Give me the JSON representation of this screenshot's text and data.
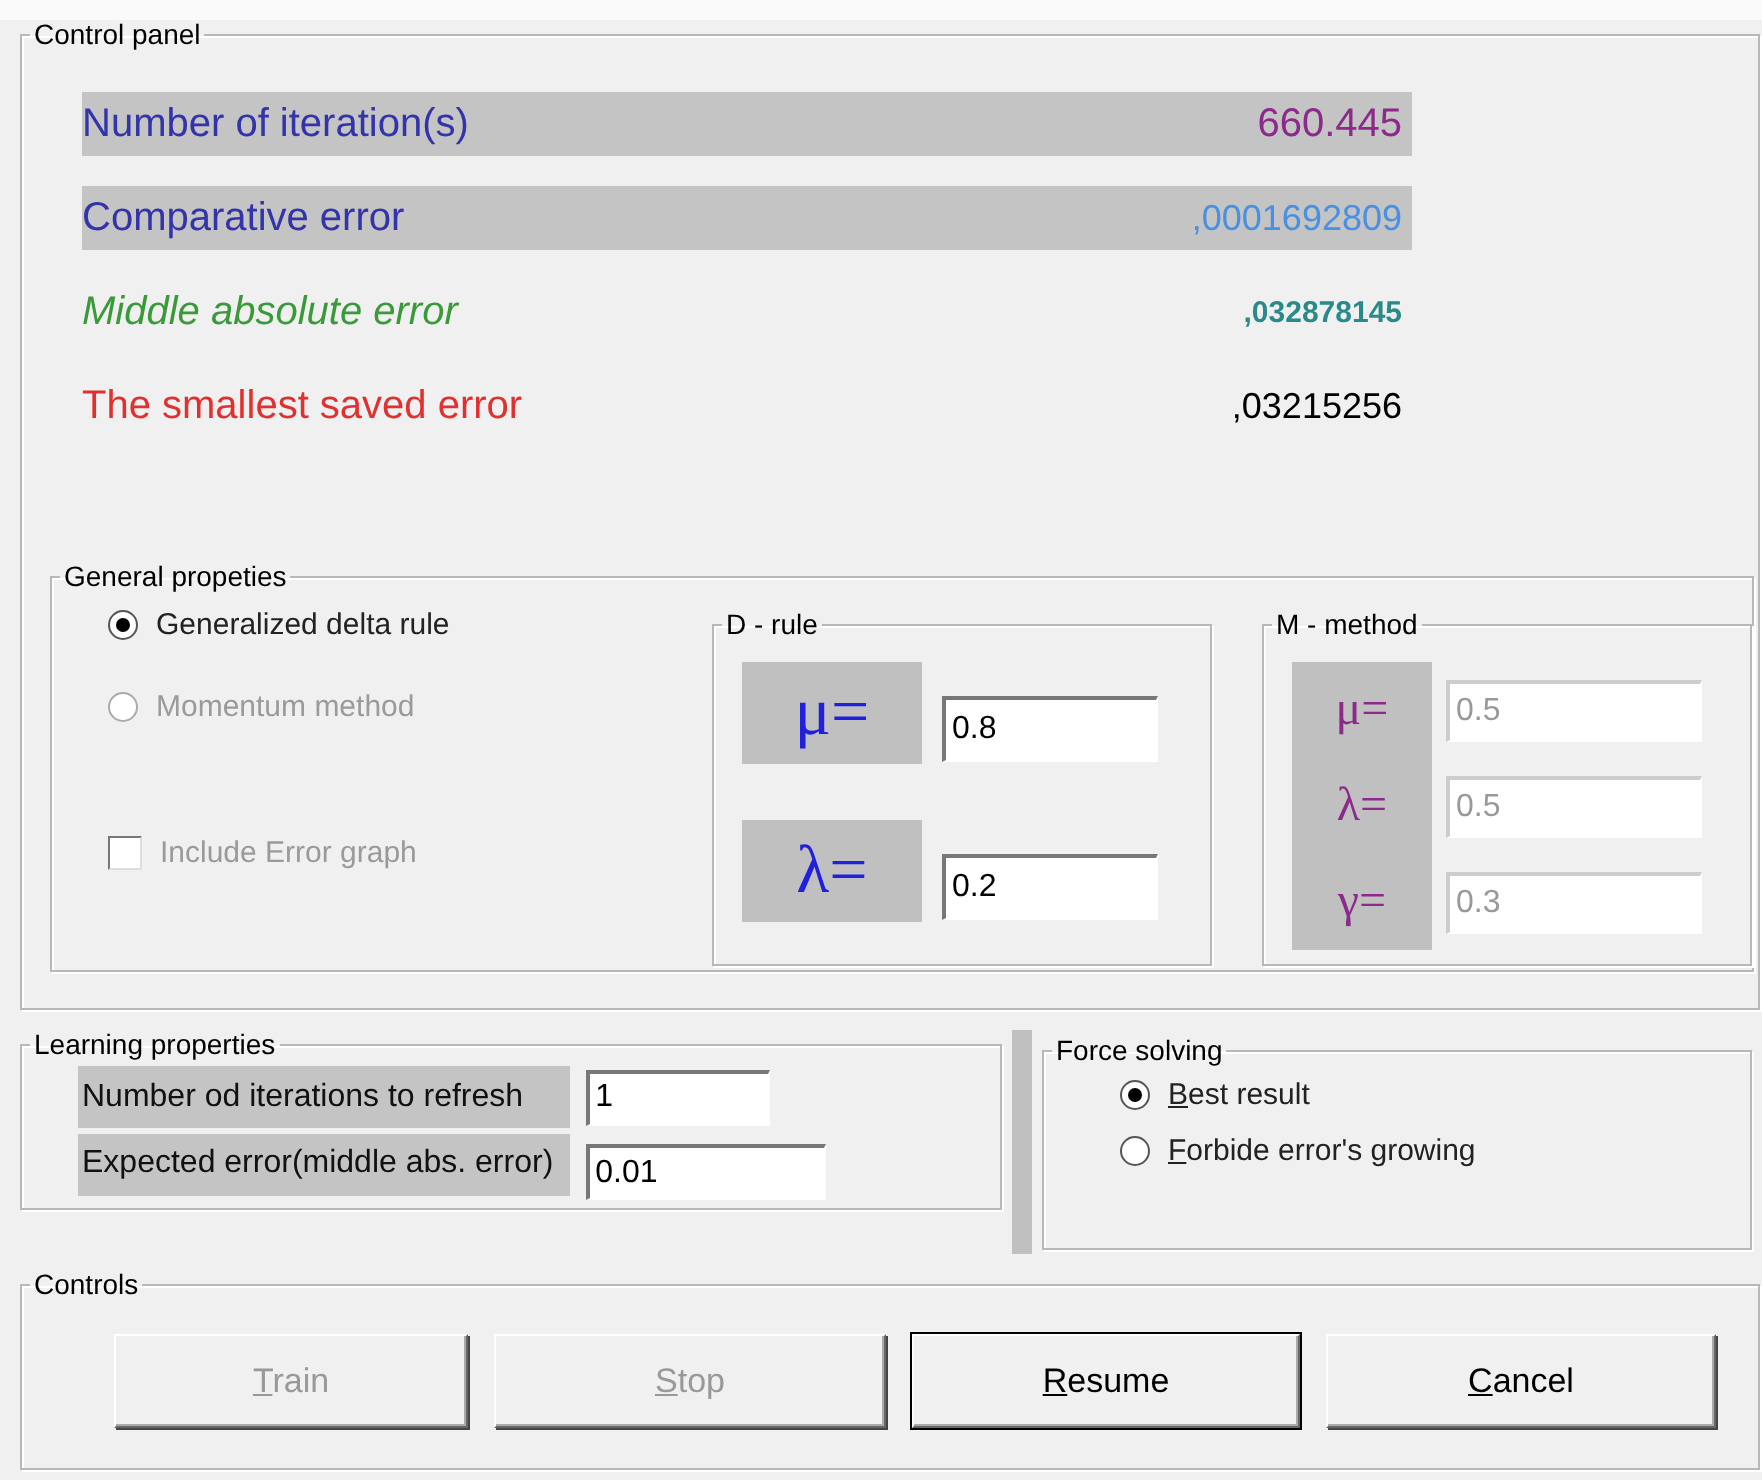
{
  "panel": {
    "title": "Control panel",
    "stats": [
      {
        "kind": "iterations",
        "label": "Number of iteration(s)",
        "value": "660.445"
      },
      {
        "kind": "comparative",
        "label": "Comparative error",
        "value": ",0001692809"
      },
      {
        "kind": "middle",
        "label": "Middle absolute error",
        "value": ",032878145"
      },
      {
        "kind": "smallest",
        "label": "The smallest saved error",
        "value": ",03215256"
      }
    ]
  },
  "general": {
    "title": "General propeties",
    "methods": [
      {
        "label": "Generalized delta rule",
        "selected": true,
        "disabled": false
      },
      {
        "label": "Momentum method",
        "selected": false,
        "disabled": true
      }
    ],
    "error_graph": {
      "label": "Include Error graph",
      "checked": false,
      "disabled": true
    },
    "d_rule": {
      "title": "D - rule",
      "params": [
        {
          "symbol": "μ=",
          "value": "0.8",
          "disabled": false
        },
        {
          "symbol": "λ=",
          "value": "0.2",
          "disabled": false
        }
      ]
    },
    "m_method": {
      "title": "M - method",
      "params": [
        {
          "symbol": "μ=",
          "value": "0.5",
          "disabled": true
        },
        {
          "symbol": "λ=",
          "value": "0.5",
          "disabled": true
        },
        {
          "symbol": "γ=",
          "value": "0.3",
          "disabled": true
        }
      ]
    }
  },
  "learning": {
    "title": "Learning properties",
    "fields": [
      {
        "label": "Number od iterations to refresh",
        "value": "1"
      },
      {
        "label": "Expected error(middle abs. error)",
        "value": "0.01"
      }
    ]
  },
  "force_solving": {
    "title": "Force solving",
    "options": [
      {
        "label": "Best result",
        "underline_first": true,
        "selected": true
      },
      {
        "label": "Forbide error's growing",
        "underline_first": true,
        "selected": false
      }
    ]
  },
  "controls": {
    "title": "Controls",
    "buttons": [
      {
        "label": "Train",
        "underline_first": true,
        "disabled": true,
        "default": false
      },
      {
        "label": "Stop",
        "underline_first": true,
        "disabled": true,
        "default": false
      },
      {
        "label": "Resume",
        "underline_first": true,
        "disabled": false,
        "default": true
      },
      {
        "label": "Cancel",
        "underline_first": true,
        "disabled": false,
        "default": false
      }
    ]
  }
}
